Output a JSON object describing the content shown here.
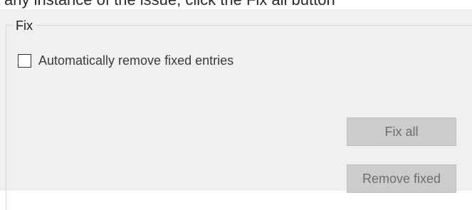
{
  "header_snippet": "any instance of the issue, click the Fix all button",
  "group": {
    "title": "Fix",
    "checkbox": {
      "label": "Automatically remove fixed entries",
      "checked": false
    }
  },
  "buttons": {
    "fix_all": "Fix all",
    "remove_fixed": "Remove fixed"
  },
  "colors": {
    "panel_bg": "#f0f0f0",
    "button_bg": "#cccccc",
    "button_text": "#6d6d6d"
  }
}
